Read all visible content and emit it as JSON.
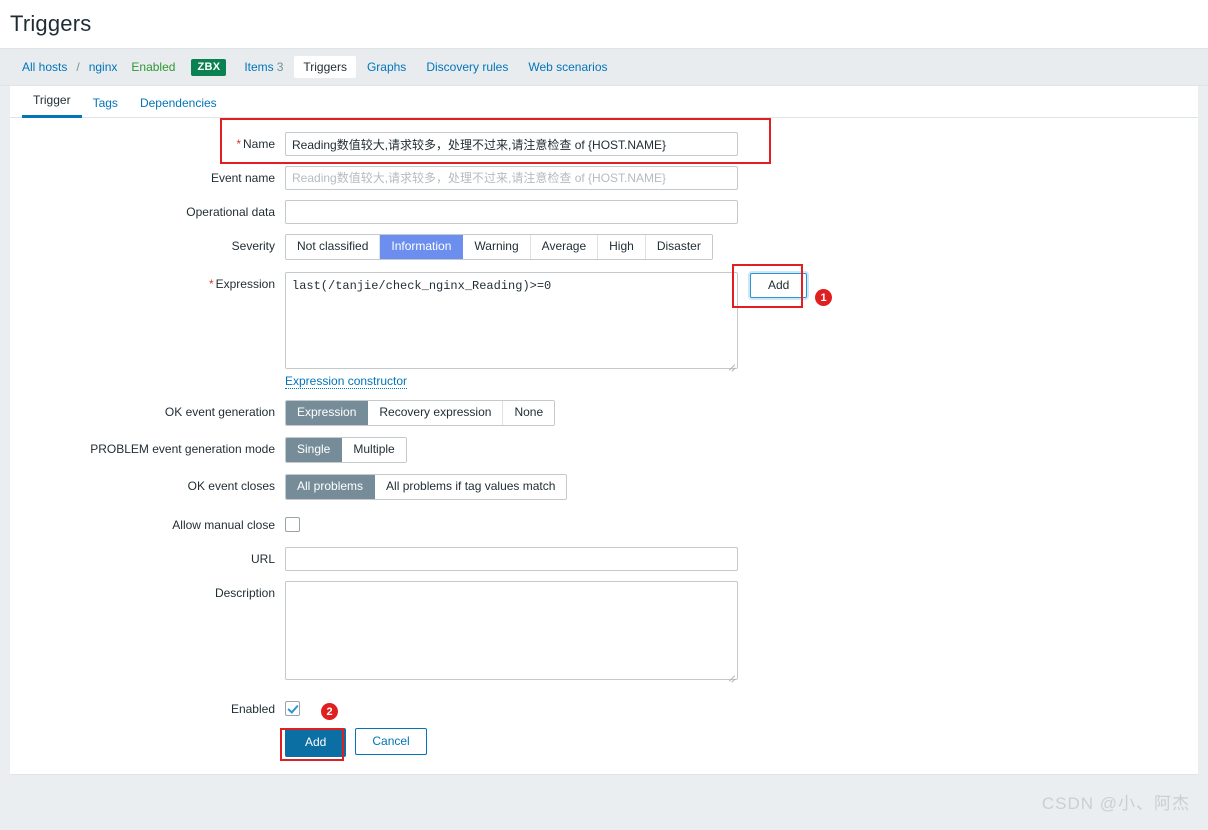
{
  "page": {
    "title": "Triggers",
    "watermark": "CSDN @小、阿杰"
  },
  "object_nav": {
    "all_hosts": "All hosts",
    "separator": "/",
    "host": "nginx",
    "status": "Enabled",
    "agent_badge": "ZBX",
    "links": [
      {
        "label": "Items",
        "count": "3",
        "selected": false
      },
      {
        "label": "Triggers",
        "count": "",
        "selected": true
      },
      {
        "label": "Graphs",
        "count": "",
        "selected": false
      },
      {
        "label": "Discovery rules",
        "count": "",
        "selected": false
      },
      {
        "label": "Web scenarios",
        "count": "",
        "selected": false
      }
    ]
  },
  "tabs": [
    {
      "label": "Trigger",
      "active": true
    },
    {
      "label": "Tags",
      "active": false
    },
    {
      "label": "Dependencies",
      "active": false
    }
  ],
  "form": {
    "name": {
      "label": "Name",
      "required": "*",
      "value": "Reading数值较大,请求较多，处理不过来,请注意检查 of {HOST.NAME}"
    },
    "event_name": {
      "label": "Event name",
      "value": "",
      "placeholder": "Reading数值较大,请求较多，处理不过来,请注意检查 of {HOST.NAME}"
    },
    "operational_data": {
      "label": "Operational data",
      "value": "",
      "placeholder": ""
    },
    "severity": {
      "label": "Severity",
      "options": [
        "Not classified",
        "Information",
        "Warning",
        "Average",
        "High",
        "Disaster"
      ],
      "selected": "Information"
    },
    "expression": {
      "label": "Expression",
      "required": "*",
      "value": "last(/tanjie/check_nginx_Reading)>=0",
      "add_button": "Add",
      "constructor_link": "Expression constructor"
    },
    "ok_event_generation": {
      "label": "OK event generation",
      "options": [
        "Expression",
        "Recovery expression",
        "None"
      ],
      "selected": "Expression"
    },
    "problem_event_generation_mode": {
      "label": "PROBLEM event generation mode",
      "options": [
        "Single",
        "Multiple"
      ],
      "selected": "Single"
    },
    "ok_event_closes": {
      "label": "OK event closes",
      "options": [
        "All problems",
        "All problems if tag values match"
      ],
      "selected": "All problems"
    },
    "allow_manual_close": {
      "label": "Allow manual close",
      "checked": false
    },
    "url": {
      "label": "URL",
      "value": "",
      "placeholder": ""
    },
    "description": {
      "label": "Description",
      "value": "",
      "placeholder": ""
    },
    "enabled": {
      "label": "Enabled",
      "checked": true
    },
    "footer": {
      "submit": "Add",
      "cancel": "Cancel"
    }
  },
  "annotations": [
    {
      "badge": "1"
    },
    {
      "badge": "2"
    }
  ]
}
